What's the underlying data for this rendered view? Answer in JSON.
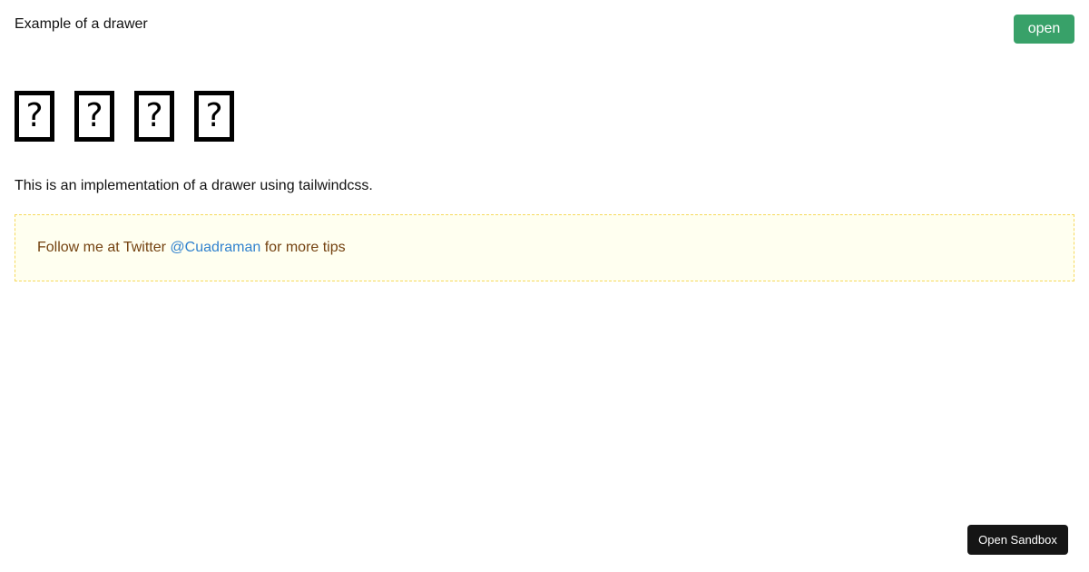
{
  "header": {
    "title": "Example of a drawer",
    "open_label": "open"
  },
  "glyphs": [
    "?",
    "?",
    "?",
    "?"
  ],
  "main": {
    "description": "This is an implementation of a drawer using tailwindcss."
  },
  "tip": {
    "prefix": "Follow me at Twitter ",
    "link": "@Cuadraman",
    "suffix": " for more tips"
  },
  "sandbox": {
    "label": "Open Sandbox"
  },
  "colors": {
    "open_button": "#38a169",
    "tip_background": "#fffff0",
    "tip_border": "#f6d95c",
    "tip_text": "#744210",
    "link": "#3182ce",
    "sandbox_button": "#151515"
  }
}
